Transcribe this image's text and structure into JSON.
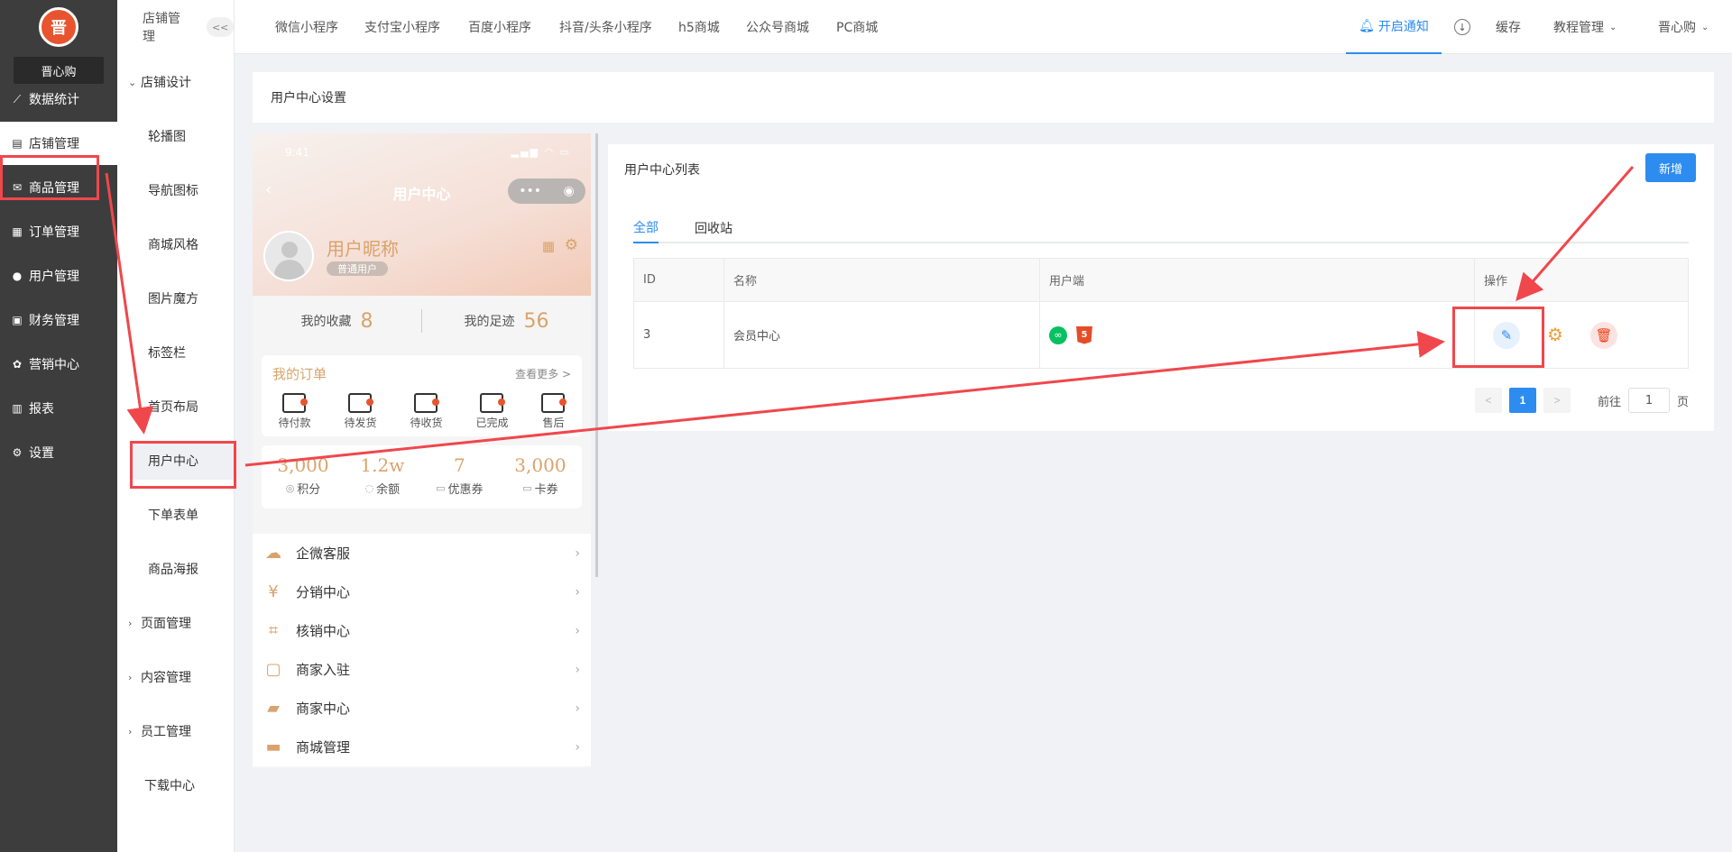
{
  "sidebar": {
    "logo_text": "晋",
    "shop_name": "晋心购",
    "items": [
      {
        "label": "数据统计",
        "icon": "chart-icon",
        "glyph": "⟋"
      },
      {
        "label": "店铺管理",
        "icon": "shop-icon",
        "glyph": "▤"
      },
      {
        "label": "商品管理",
        "icon": "goods-icon",
        "glyph": "✉"
      },
      {
        "label": "订单管理",
        "icon": "order-icon",
        "glyph": "▦"
      },
      {
        "label": "用户管理",
        "icon": "user-icon",
        "glyph": "●"
      },
      {
        "label": "财务管理",
        "icon": "finance-icon",
        "glyph": "▣"
      },
      {
        "label": "营销中心",
        "icon": "marketing-icon",
        "glyph": "✿"
      },
      {
        "label": "报表",
        "icon": "report-icon",
        "glyph": "▥"
      },
      {
        "label": "设置",
        "icon": "settings-icon",
        "glyph": "⚙"
      }
    ]
  },
  "subnav": {
    "title": "店铺管理",
    "collapse": "<<",
    "group_design": "店铺设计",
    "leaves": [
      "轮播图",
      "导航图标",
      "商城风格",
      "图片魔方",
      "标签栏",
      "首页布局",
      "用户中心",
      "下单表单",
      "商品海报"
    ],
    "groups_after": [
      "页面管理",
      "内容管理",
      "员工管理"
    ],
    "download": "下载中心"
  },
  "topbar": {
    "tabs": [
      "微信小程序",
      "支付宝小程序",
      "百度小程序",
      "抖音/头条小程序",
      "h5商城",
      "公众号商城",
      "PC商城"
    ],
    "notify": "开启通知",
    "cache": "缓存",
    "tutorial": "教程管理",
    "user": "晋心购"
  },
  "page": {
    "header": "用户中心设置"
  },
  "phone": {
    "time": "9:41",
    "title": "用户中心",
    "nickname": "用户昵称",
    "badge": "普通用户",
    "fav_label": "我的收藏",
    "fav_count": "8",
    "trace_label": "我的足迹",
    "trace_count": "56",
    "order_title": "我的订单",
    "order_more": "查看更多 >",
    "order_items": [
      "待付款",
      "待发货",
      "待收货",
      "已完成",
      "售后"
    ],
    "assets": [
      {
        "value": "3,000",
        "label": "积分",
        "icon": "◎"
      },
      {
        "value": "1.2w",
        "label": "余额",
        "icon": "◌"
      },
      {
        "value": "7",
        "label": "优惠券",
        "icon": "▭"
      },
      {
        "value": "3,000",
        "label": "卡券",
        "icon": "▭"
      }
    ],
    "menus": [
      {
        "label": "企微客服",
        "icon": "wechat-work-icon",
        "glyph": "☁"
      },
      {
        "label": "分销中心",
        "icon": "distribution-icon",
        "glyph": "¥"
      },
      {
        "label": "核销中心",
        "icon": "verify-icon",
        "glyph": "⌗"
      },
      {
        "label": "商家入驻",
        "icon": "merchant-join-icon",
        "glyph": "▢"
      },
      {
        "label": "商家中心",
        "icon": "merchant-center-icon",
        "glyph": "▰"
      },
      {
        "label": "商城管理",
        "icon": "mall-manage-icon",
        "glyph": "▬"
      }
    ]
  },
  "list": {
    "title": "用户中心列表",
    "add_label": "新增",
    "tabs": [
      "全部",
      "回收站"
    ],
    "columns": [
      "ID",
      "名称",
      "用户端",
      "操作"
    ],
    "rows": [
      {
        "id": "3",
        "name": "会员中心"
      }
    ],
    "pager": {
      "prev": "<",
      "current": "1",
      "next": ">",
      "goto_label": "前往",
      "goto_value": "1",
      "page_unit": "页"
    }
  },
  "colors": {
    "primary": "#2d8cf0",
    "sidebar_bg": "#3d3d3d",
    "accent_gold": "#d9a36b",
    "annotation_red": "#f0474c"
  }
}
